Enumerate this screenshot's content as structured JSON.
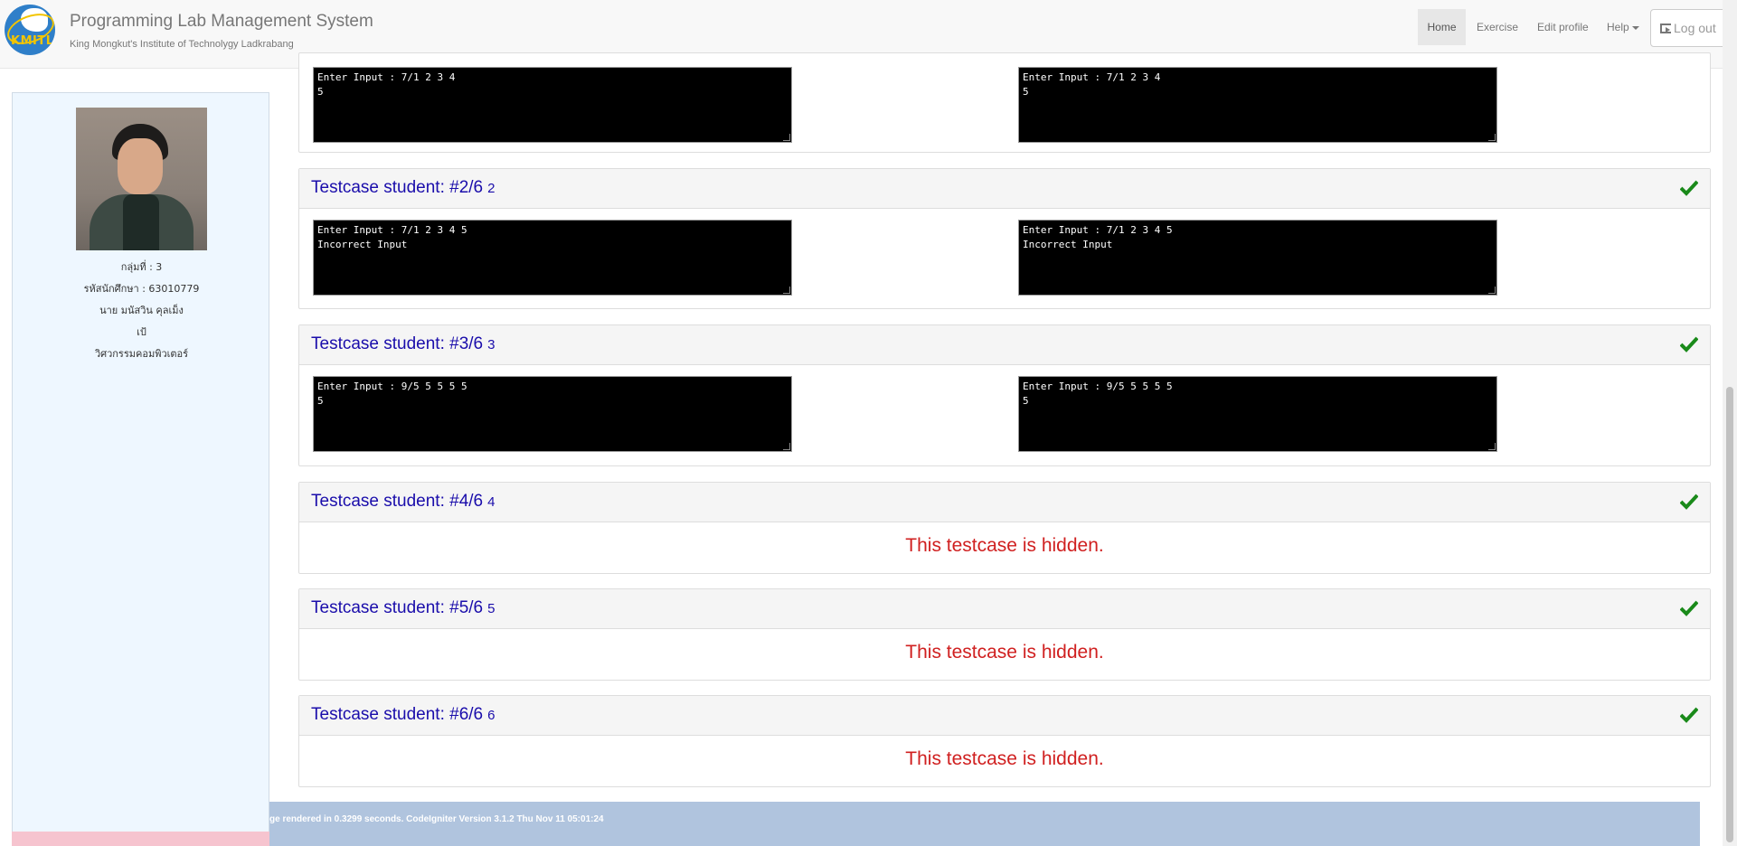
{
  "header": {
    "title": "Programming Lab Management System",
    "subtitle": "King Mongkut's Institute of Technolygy Ladkrabang",
    "logo_text": "KMITL",
    "nav": {
      "home": "Home",
      "exercise": "Exercise",
      "edit_profile": "Edit profile",
      "help": "Help",
      "logout": "Log out"
    }
  },
  "sidebar": {
    "group": "กลุ่มที่ : 3",
    "student_id": "รหัสนักศึกษา : 63010779",
    "name": "นาย มนัสวิน คุลเม็ง",
    "nickname": "เป้",
    "department": "วิศวกรรมคอมพิวเตอร์"
  },
  "testcases": [
    {
      "title": "",
      "number": "",
      "expected": "Enter Input : 7/1 2 3 4\n5",
      "output": "Enter Input : 7/1 2 3 4\n5"
    },
    {
      "title": "Testcase student: #2/6",
      "number": "2",
      "expected": "Enter Input : 7/1 2 3 4 5\nIncorrect Input",
      "output": "Enter Input : 7/1 2 3 4 5\nIncorrect Input"
    },
    {
      "title": "Testcase student: #3/6",
      "number": "3",
      "expected": "Enter Input : 9/5 5 5 5 5\n5",
      "output": "Enter Input : 9/5 5 5 5 5\n5"
    },
    {
      "title": "Testcase student: #4/6",
      "number": "4",
      "hidden_msg": "This testcase is hidden."
    },
    {
      "title": "Testcase student: #5/6",
      "number": "5",
      "hidden_msg": "This testcase is hidden."
    },
    {
      "title": "Testcase student: #6/6",
      "number": "6",
      "hidden_msg": "This testcase is hidden."
    }
  ],
  "footer": {
    "text": "ge rendered in 0.3299 seconds. CodeIgniter Version 3.1.2 Thu Nov 11 05:01:24"
  },
  "colors": {
    "pass": "#1a8a1a",
    "link": "#1a0dab",
    "hidden": "#d02020"
  }
}
